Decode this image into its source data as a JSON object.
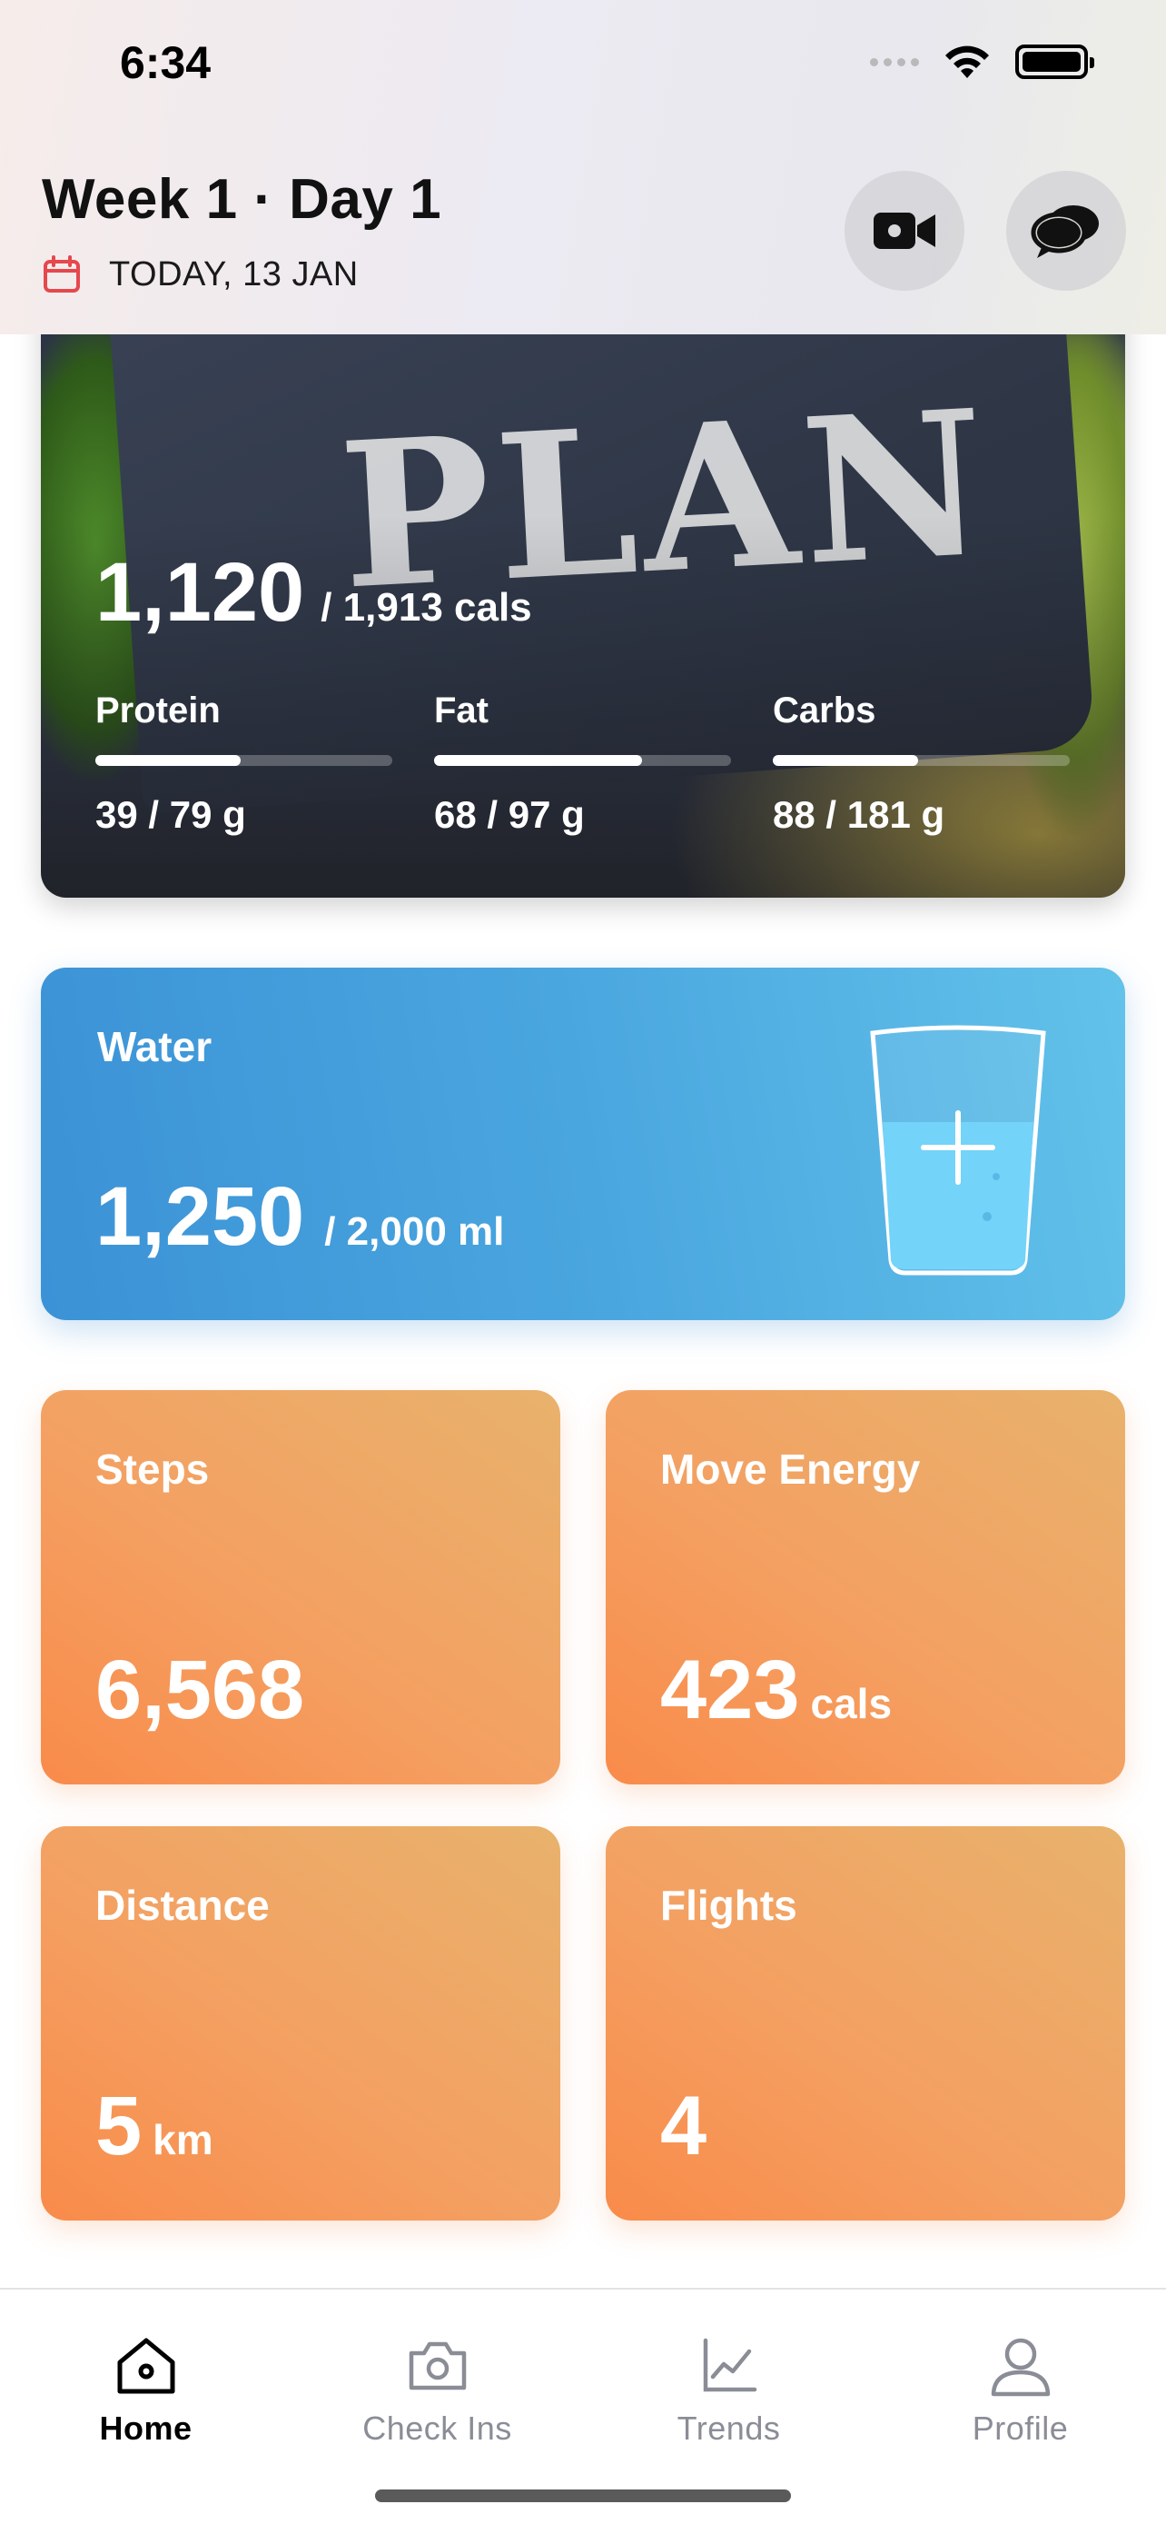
{
  "status_bar": {
    "time": "6:34"
  },
  "header": {
    "title": "Week 1 · Day 1",
    "date": "TODAY, 13 JAN",
    "icons": [
      "calendar-icon",
      "video-icon",
      "chat-icon"
    ]
  },
  "meal_plan": {
    "image_text": "PLAN",
    "calories": "1,120",
    "calories_total": "/ 1,913 cals",
    "macros": [
      {
        "label": "Protein",
        "value": "39 / 79 g",
        "progress": 0.49
      },
      {
        "label": "Fat",
        "value": "68 / 97 g",
        "progress": 0.7
      },
      {
        "label": "Carbs",
        "value": "88 / 181 g",
        "progress": 0.49
      }
    ]
  },
  "water": {
    "title": "Water",
    "value": "1,250",
    "total": "/  2,000 ml",
    "progress": 0.625,
    "accent": "#4aa6df"
  },
  "tiles": [
    {
      "title": "Steps",
      "value": "6,568",
      "unit": ""
    },
    {
      "title": "Move Energy",
      "value": "423",
      "unit": "cals"
    },
    {
      "title": "Distance",
      "value": "5",
      "unit": "km"
    },
    {
      "title": "Flights",
      "value": "4",
      "unit": ""
    }
  ],
  "tabbar": {
    "tabs": [
      {
        "label": "Home",
        "icon": "home-icon",
        "active": true
      },
      {
        "label": "Check Ins",
        "icon": "camera-icon",
        "active": false
      },
      {
        "label": "Trends",
        "icon": "chart-icon",
        "active": false
      },
      {
        "label": "Profile",
        "icon": "person-icon",
        "active": false
      }
    ]
  },
  "colors": {
    "tile_orange": "#f4a062",
    "water_blue": "#4aa6df",
    "calendar_red": "#e5484d"
  }
}
